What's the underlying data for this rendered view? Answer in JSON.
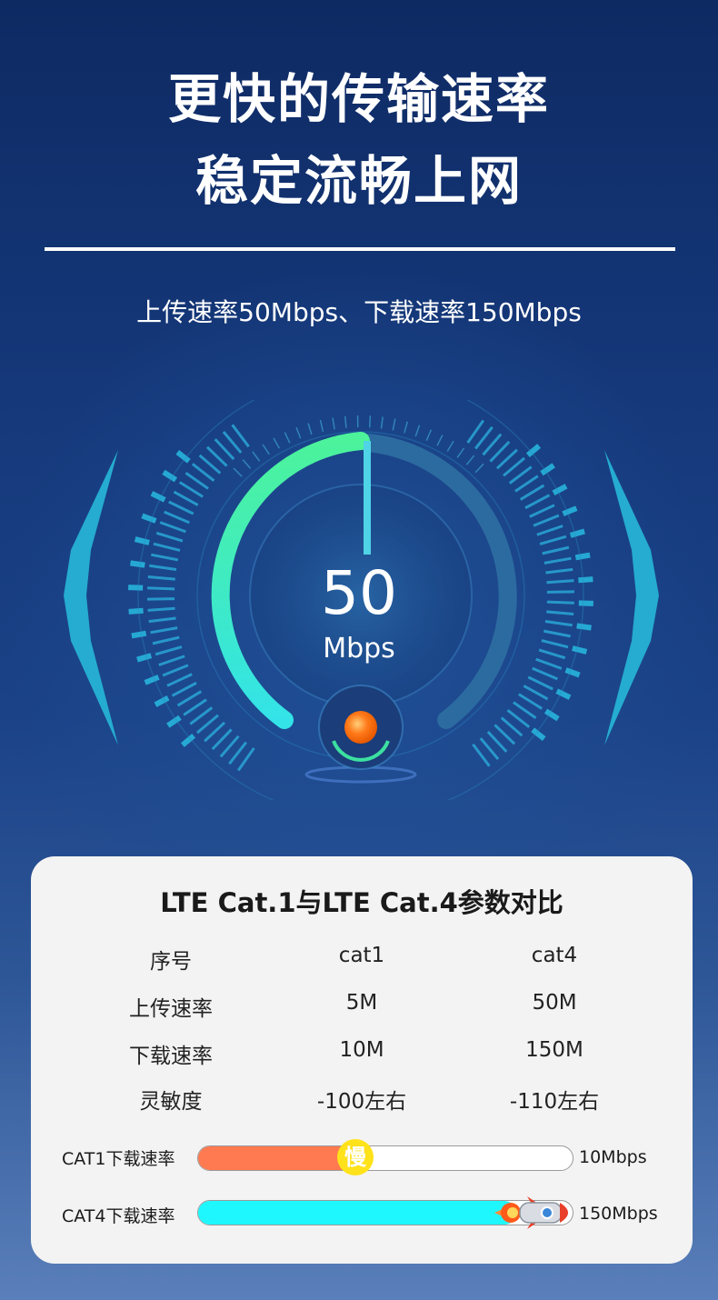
{
  "headline": {
    "line1": "更快的传输速率",
    "line2": "稳定流畅上网"
  },
  "subtitle": "上传速率50Mbps、下载速率150Mbps",
  "gauge": {
    "value": "50",
    "unit": "Mbps",
    "level": 0.5
  },
  "comparison": {
    "title": "LTE Cat.1与LTE Cat.4参数对比",
    "rows": [
      [
        "序号",
        "cat1",
        "cat4"
      ],
      [
        "上传速率",
        "5M",
        "50M"
      ],
      [
        "下载速率",
        "10M",
        "150M"
      ],
      [
        "灵敏度",
        "-100左右",
        "-110左右"
      ]
    ],
    "bars": [
      {
        "label": "CAT1下载速率",
        "value": "10Mbps",
        "fraction": 0.42,
        "color": "#ff7a50",
        "badge": "慢"
      },
      {
        "label": "CAT4下载速率",
        "value": "150Mbps",
        "fraction": 0.85,
        "color": "#1ff7ff",
        "icon": "rocket-icon"
      }
    ]
  }
}
